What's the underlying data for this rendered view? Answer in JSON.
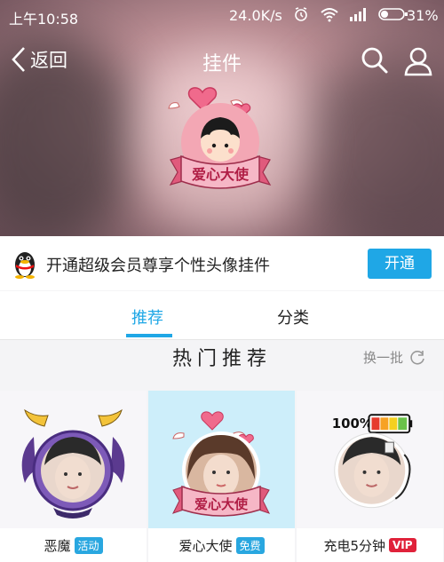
{
  "status": {
    "time": "上午10:58",
    "speed": "24.0K/s",
    "battery": "31%"
  },
  "nav": {
    "back_label": "返回",
    "title": "挂件"
  },
  "hero": {
    "badge_text": "爱心大使"
  },
  "vip_banner": {
    "text": "开通超级会员尊享个性头像挂件",
    "button": "开通"
  },
  "tabs": [
    {
      "label": "推荐",
      "active": true
    },
    {
      "label": "分类",
      "active": false
    }
  ],
  "section": {
    "title": "热门推荐",
    "refresh_label": "换一批"
  },
  "items": [
    {
      "name": "恶魔",
      "tag": "活动",
      "tag_color": "#29a7e0"
    },
    {
      "name": "爱心大使",
      "tag": "免费",
      "tag_color": "#29a7e0",
      "badge_text": "爱心大使"
    },
    {
      "name": "充电5分钟",
      "tag": "VIP",
      "tag_color": "#e0223a",
      "battery_text": "100%"
    }
  ],
  "colors": {
    "accent": "#1fa7e6"
  }
}
